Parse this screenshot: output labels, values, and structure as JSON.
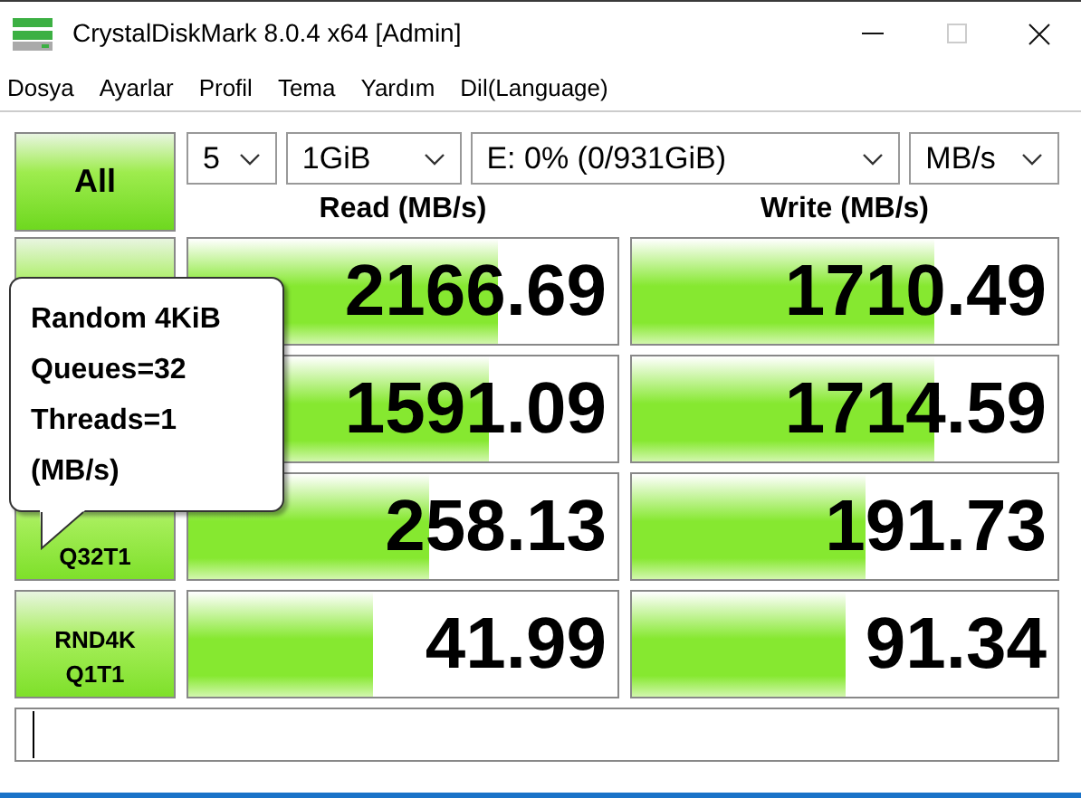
{
  "window": {
    "title": "CrystalDiskMark 8.0.4 x64 [Admin]"
  },
  "menu": [
    "Dosya",
    "Ayarlar",
    "Profil",
    "Tema",
    "Yardım",
    "Dil(Language)"
  ],
  "all_button": "All",
  "selectors": [
    {
      "value": "5"
    },
    {
      "value": "1GiB"
    },
    {
      "value": "E: 0% (0/931GiB)"
    },
    {
      "value": "MB/s"
    }
  ],
  "columns": [
    "Read (MB/s)",
    "Write (MB/s)"
  ],
  "tests": [
    {
      "read": {
        "reading": "2166.69",
        "level": 0.72
      },
      "write": {
        "reading": "1710.49",
        "level": 0.71
      }
    },
    {
      "read": {
        "reading": "1591.09",
        "level": 0.7
      },
      "write": {
        "reading": "1714.59",
        "level": 0.71
      }
    },
    {
      "lines": [
        "Q32T1"
      ],
      "read": {
        "reading": "258.13",
        "level": 0.56
      },
      "write": {
        "reading": "191.73",
        "level": 0.55
      }
    },
    {
      "lines": [
        "RND4K",
        "Q1T1"
      ],
      "read": {
        "reading": "41.99",
        "level": 0.43
      },
      "write": {
        "reading": "91.34",
        "level": 0.5
      }
    }
  ],
  "tooltip": [
    "Random 4KiB",
    "Queues=32",
    "Threads=1",
    "(MB/s)"
  ]
}
